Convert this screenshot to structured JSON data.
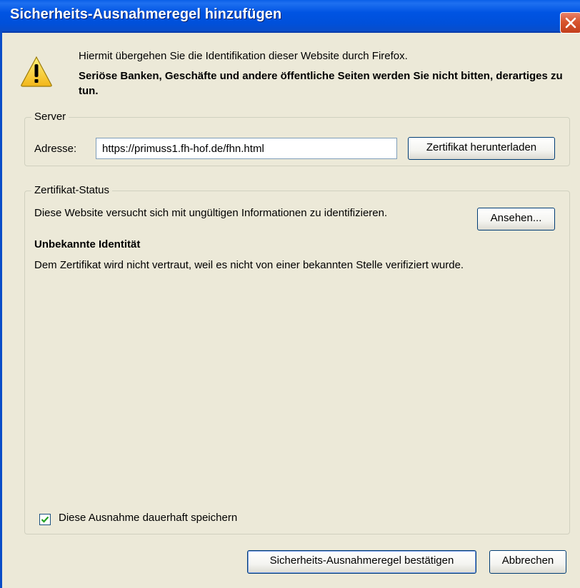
{
  "window": {
    "title": "Sicherheits-Ausnahmeregel hinzufügen"
  },
  "intro": {
    "text": "Hiermit übergehen Sie die Identifikation dieser Website durch Firefox.",
    "warning": "Seriöse Banken, Geschäfte und andere öffentliche Seiten werden Sie nicht bitten, derartiges zu tun."
  },
  "server": {
    "group_label": "Server",
    "address_label": "Adresse:",
    "address_value": "https://primuss1.fh-hof.de/fhn.html",
    "download_button": "Zertifikat herunterladen"
  },
  "certificate_status": {
    "group_label": "Zertifikat-Status",
    "message": "Diese Website versucht sich mit ungültigen Informationen zu identifizieren.",
    "view_button": "Ansehen...",
    "heading": "Unbekannte Identität",
    "detail": "Dem Zertifikat wird nicht vertraut, weil es nicht von einer bekannten Stelle verifiziert wurde.",
    "permanent_checkbox_label": "Diese Ausnahme dauerhaft speichern",
    "permanent_checked": true
  },
  "footer": {
    "confirm_button": "Sicherheits-Ausnahmeregel bestätigen",
    "cancel_button": "Abbrechen"
  },
  "icons": {
    "warning": "warning-icon",
    "close": "close-icon",
    "check": "check-icon"
  },
  "colors": {
    "titlebar": "#0054E3",
    "dialog_bg": "#ECE9D8",
    "close_button": "#D8542E",
    "warning_yellow": "#F4C430"
  }
}
